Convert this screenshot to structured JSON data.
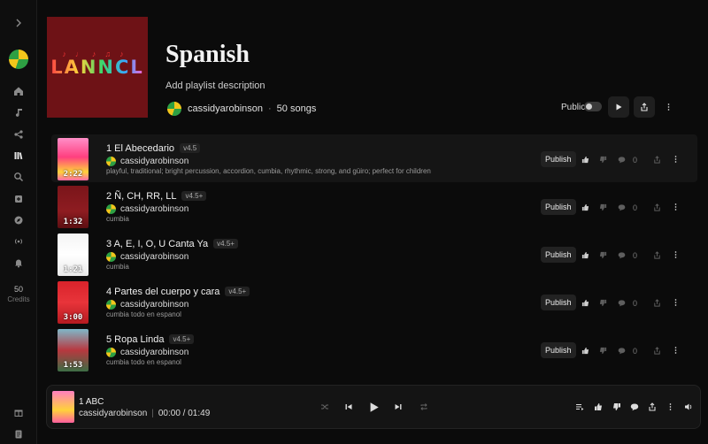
{
  "playlist": {
    "title": "Spanish",
    "description": "Add playlist description",
    "owner": "cassidyarobinson",
    "dot": "·",
    "song_count": "50 songs",
    "public_label": "Public",
    "cover_text": "LANNCL",
    "cover_notes": "♪♩♪♫♪"
  },
  "sidebar": {
    "credits_value": "50",
    "credits_label": "Credits"
  },
  "songs": [
    {
      "title": "1 El Abecedario",
      "version": "v4.5",
      "artist": "cassidyarobinson",
      "tags": "playful, traditional; bright percussion, accordion, cumbia, rhythmic, strong, and güiro; perfect for children",
      "duration": "2:22",
      "publish": "Publish",
      "comments": "0"
    },
    {
      "title": "2 Ñ, CH, RR, LL",
      "version": "v4.5+",
      "artist": "cassidyarobinson",
      "tags": "cumbia",
      "duration": "1:32",
      "publish": "Publish",
      "comments": "0"
    },
    {
      "title": "3 A, E, I, O, U Canta Ya",
      "version": "v4.5+",
      "artist": "cassidyarobinson",
      "tags": "cumbia",
      "duration": "1:21",
      "publish": "Publish",
      "comments": "0"
    },
    {
      "title": "4 Partes del cuerpo y cara",
      "version": "v4.5+",
      "artist": "cassidyarobinson",
      "tags": "cumbia todo en espanol",
      "duration": "3:00",
      "publish": "Publish",
      "comments": "0"
    },
    {
      "title": "5 Ropa Linda",
      "version": "v4.5+",
      "artist": "cassidyarobinson",
      "tags": "cumbia todo en espanol",
      "duration": "1:53",
      "publish": "Publish",
      "comments": "0"
    }
  ],
  "player": {
    "title": "1 ABC",
    "artist": "cassidyarobinson",
    "separator": "|",
    "current_time": "00:00 /",
    "total_time": "01:49"
  },
  "colors": {
    "background": "#0b0b0b",
    "cover_bg": "#6e1216",
    "accent_green": "#2ea043",
    "accent_yellow": "#f2c61b"
  }
}
